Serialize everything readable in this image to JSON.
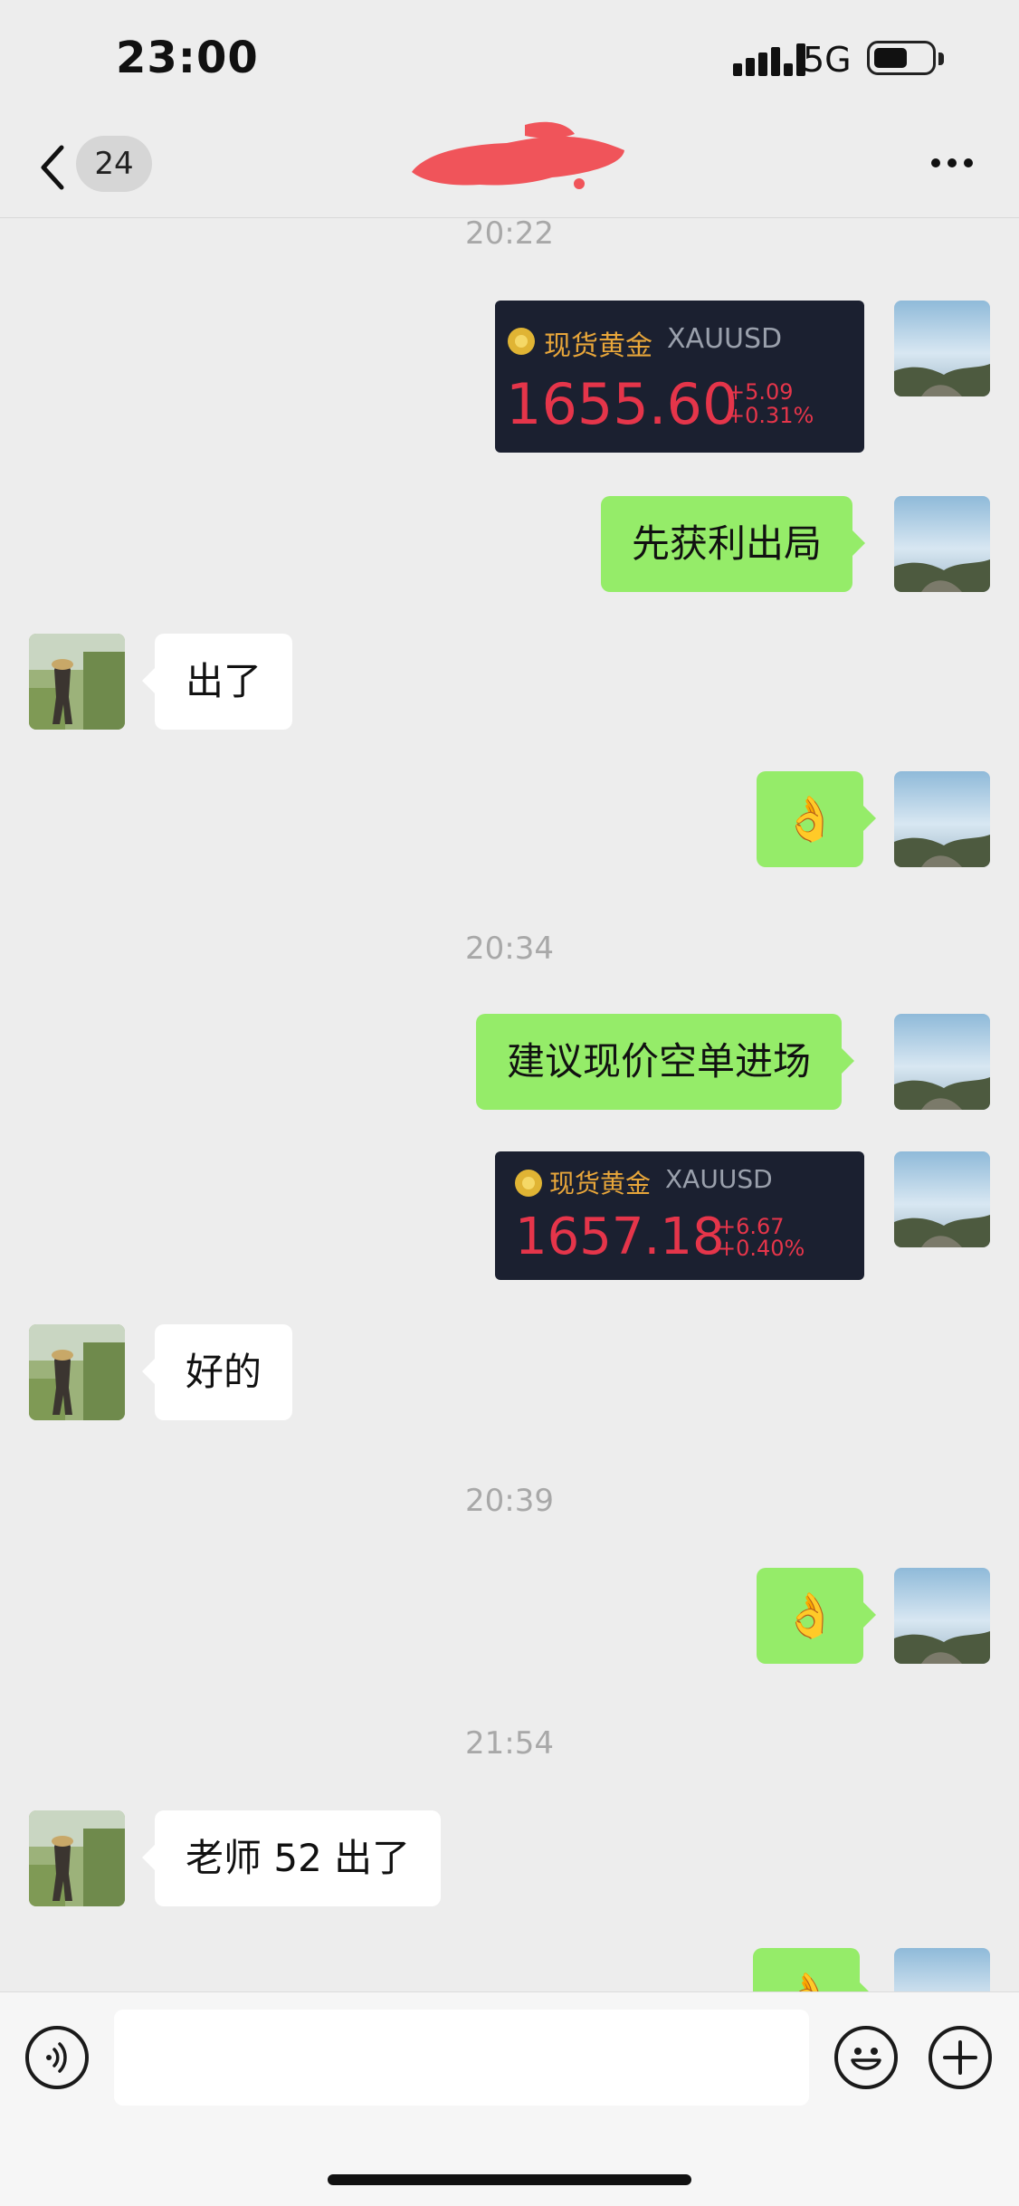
{
  "status_bar": {
    "time": "23:00",
    "network": "5G",
    "signal_icon": "cellular-signal-icon",
    "battery_icon": "battery-icon"
  },
  "nav": {
    "back_icon": "chevron-left-icon",
    "unread_count": "24",
    "title_redacted": true,
    "more_icon": "more-dots-icon"
  },
  "colors": {
    "my_bubble": "#95ec69",
    "their_bubble": "#ffffff",
    "background": "#ededed",
    "quote_bg": "#1b2030",
    "quote_red": "#e5354a",
    "quote_gold": "#e8a63a"
  },
  "messages": {
    "t1": "20:22",
    "quote1": {
      "title": "现货黄金",
      "symbol": "XAUUSD",
      "price": "1655.60",
      "change": "+5.09",
      "change_pct": "+0.31%"
    },
    "m1": "先获利出局",
    "m2": "出了",
    "m3": "👌",
    "t2": "20:34",
    "m4": "建议现价空单进场",
    "quote2": {
      "title": "现货黄金",
      "symbol": "XAUUSD",
      "price": "1657.18",
      "change": "+6.67",
      "change_pct": "+0.40%"
    },
    "m5": "好的",
    "t3": "20:39",
    "m6": "👌",
    "t4": "21:54",
    "m7": "老师 52 出了",
    "m8": "👌"
  },
  "input_bar": {
    "voice_icon": "voice-input-icon",
    "emoji_icon": "emoji-icon",
    "plus_icon": "plus-icon",
    "text_value": ""
  }
}
